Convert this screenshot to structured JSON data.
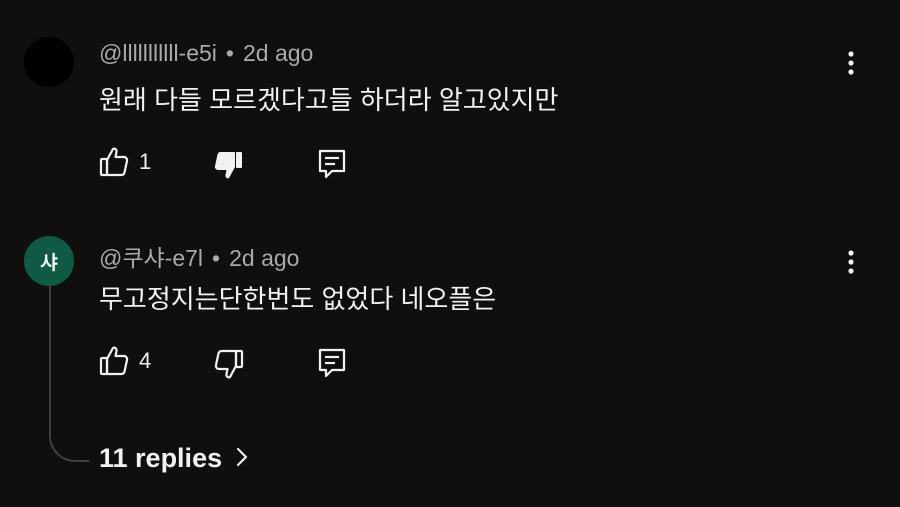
{
  "comments": [
    {
      "avatar_color": "#000000",
      "avatar_text": "",
      "author": "@lllllllllll-e5i",
      "separator": "•",
      "time": "2d ago",
      "text": "원래 다들 모르겠다고들 하더라 알고있지만",
      "likes": "1",
      "dislike_active": true,
      "icons": {
        "like": "thumbs-up-icon",
        "dislike": "thumbs-down-icon",
        "reply": "reply-icon",
        "menu": "more-vert-icon"
      }
    },
    {
      "avatar_color": "#0e5a45",
      "avatar_text": "샤",
      "author": "@쿠샤-e7l",
      "separator": "•",
      "time": "2d ago",
      "text": "무고정지는단한번도 없었다 네오플은",
      "likes": "4",
      "dislike_active": false,
      "icons": {
        "like": "thumbs-up-icon",
        "dislike": "thumbs-down-icon",
        "reply": "reply-icon",
        "menu": "more-vert-icon"
      }
    }
  ],
  "replies": {
    "label": "11 replies",
    "icon": "chevron-right-icon"
  }
}
